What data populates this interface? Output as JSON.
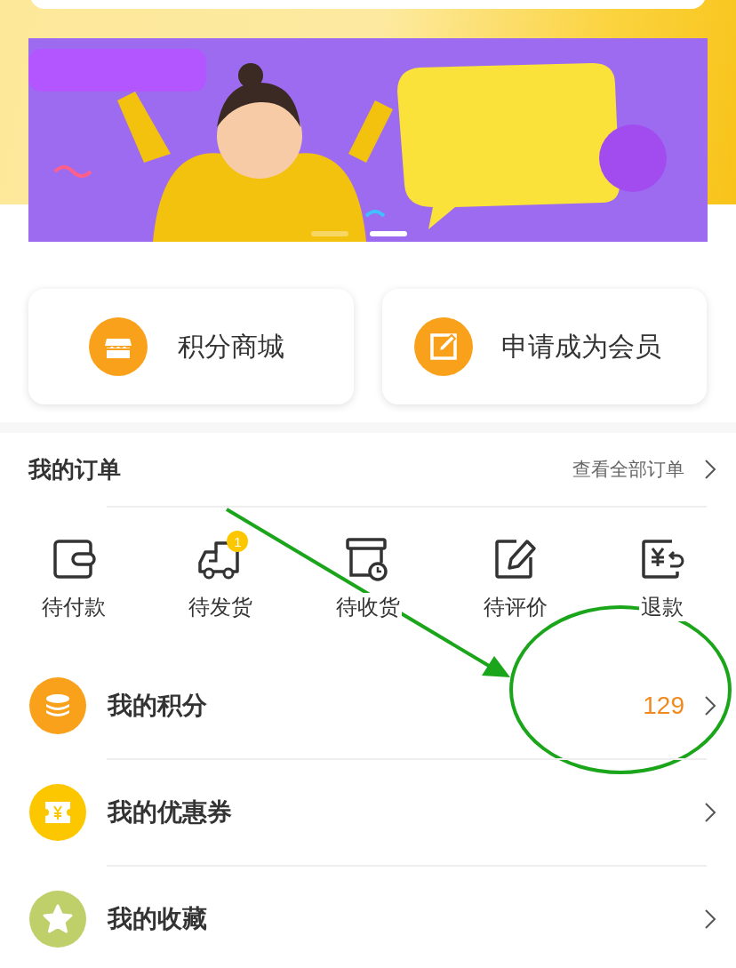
{
  "banner": {
    "kind": "picture",
    "dots": [
      {
        "selected": false
      },
      {
        "selected": true
      }
    ]
  },
  "shortcuts": [
    {
      "kind": "shop",
      "label": "积分商城"
    },
    {
      "kind": "edit",
      "label": "申请成为会员"
    }
  ],
  "orders": {
    "title": "我的订单",
    "link": "查看全部订单",
    "statuses": [
      {
        "kind": "wallet",
        "label": "待付款"
      },
      {
        "kind": "truck",
        "label": "待发货",
        "badge": "1"
      },
      {
        "kind": "box",
        "label": "待收货"
      },
      {
        "kind": "pencil",
        "label": "待评价"
      },
      {
        "kind": "refund",
        "label": "退款"
      }
    ]
  },
  "menu": [
    {
      "kind": "coins",
      "label": "我的积分",
      "value": "129",
      "color": "#f9a11b"
    },
    {
      "kind": "ticket",
      "label": "我的优惠券",
      "color": "#fdc700"
    },
    {
      "kind": "star",
      "label": "我的收藏",
      "color": "#bfcf6a"
    }
  ]
}
